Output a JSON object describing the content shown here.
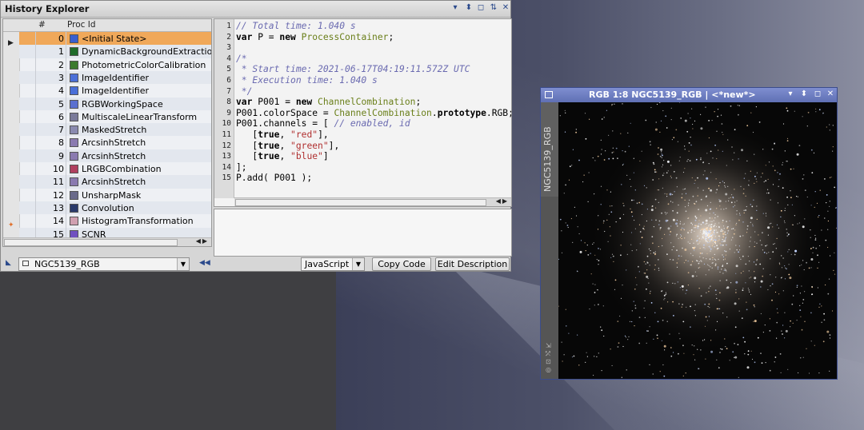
{
  "history_explorer": {
    "title": "History Explorer",
    "controls": [
      "▾",
      "⬍",
      "◻",
      "⇅",
      "✕"
    ],
    "columns": {
      "index": "#",
      "proc_id": "Proc Id"
    },
    "items": [
      {
        "index": "0",
        "label": "<Initial State>",
        "icon_color": "#3a5fd0"
      },
      {
        "index": "1",
        "label": "DynamicBackgroundExtraction",
        "icon_color": "#1f6b2a"
      },
      {
        "index": "2",
        "label": "PhotometricColorCalibration",
        "icon_color": "#3c7a2e"
      },
      {
        "index": "3",
        "label": "ImageIdentifier",
        "icon_color": "#4a6fd8"
      },
      {
        "index": "4",
        "label": "ImageIdentifier",
        "icon_color": "#4a6fd8"
      },
      {
        "index": "5",
        "label": "RGBWorkingSpace",
        "icon_color": "#5a70d0"
      },
      {
        "index": "6",
        "label": "MultiscaleLinearTransform",
        "icon_color": "#7a7a9a"
      },
      {
        "index": "7",
        "label": "MaskedStretch",
        "icon_color": "#8a8ab0"
      },
      {
        "index": "8",
        "label": "ArcsinhStretch",
        "icon_color": "#8a7ab0"
      },
      {
        "index": "9",
        "label": "ArcsinhStretch",
        "icon_color": "#8a7ab0"
      },
      {
        "index": "10",
        "label": "LRGBCombination",
        "icon_color": "#b04060"
      },
      {
        "index": "11",
        "label": "ArcsinhStretch",
        "icon_color": "#8a7ab0"
      },
      {
        "index": "12",
        "label": "UnsharpMask",
        "icon_color": "#6a6a8a"
      },
      {
        "index": "13",
        "label": "Convolution",
        "icon_color": "#2a3a6a"
      },
      {
        "index": "14",
        "label": "HistogramTransformation",
        "icon_color": "#d0a0b0"
      },
      {
        "index": "15",
        "label": "SCNR",
        "icon_color": "#7050c0"
      }
    ],
    "code_lines": [
      {
        "n": "1",
        "html": "<span class=\"cm\">// Total time: 1.040 s</span>"
      },
      {
        "n": "2",
        "html": "<span class=\"kw\">var</span> P = <span class=\"kw\">new</span> <span class=\"cls\">ProcessContainer</span>;"
      },
      {
        "n": "3",
        "html": ""
      },
      {
        "n": "4",
        "html": "<span class=\"cm\">/*</span>"
      },
      {
        "n": "5",
        "html": "<span class=\"cm\"> * Start time: 2021-06-17T04:19:11.572Z UTC</span>"
      },
      {
        "n": "6",
        "html": "<span class=\"cm\"> * Execution time: 1.040 s</span>"
      },
      {
        "n": "7",
        "html": "<span class=\"cm\"> */</span>"
      },
      {
        "n": "8",
        "html": "<span class=\"kw\">var</span> P001 = <span class=\"kw\">new</span> <span class=\"cls\">ChannelCombination</span>;"
      },
      {
        "n": "9",
        "html": "P001.colorSpace = <span class=\"cls\">ChannelCombination</span>.<span class=\"kw\">prototype</span>.RGB;"
      },
      {
        "n": "10",
        "html": "P001.channels = [ <span class=\"cm\">// enabled, id</span>"
      },
      {
        "n": "11",
        "html": "   [<span class=\"kw\">true</span>, <span class=\"str\">\"red\"</span>],"
      },
      {
        "n": "12",
        "html": "   [<span class=\"kw\">true</span>, <span class=\"str\">\"green\"</span>],"
      },
      {
        "n": "13",
        "html": "   [<span class=\"kw\">true</span>, <span class=\"str\">\"blue\"</span>]"
      },
      {
        "n": "14",
        "html": "];"
      },
      {
        "n": "15",
        "html": "P.add( P001 );"
      }
    ],
    "image_selector": "NGC5139_RGB",
    "language_selector": "JavaScript",
    "copy_code_label": "Copy Code",
    "edit_description_label": "Edit Description"
  },
  "image_window": {
    "title": "RGB 1:8 NGC5139_RGB | <*new*>",
    "side_label": "NGC5139_RGB",
    "controls": [
      "▾",
      "⬍",
      "◻",
      "✕"
    ]
  },
  "colors": {
    "selected_row": "#f0a85a",
    "image_window_frame": "#6a7ab8",
    "code_comment": "#6a6ab0",
    "code_class": "#6a7f1a",
    "code_string": "#b03030"
  }
}
